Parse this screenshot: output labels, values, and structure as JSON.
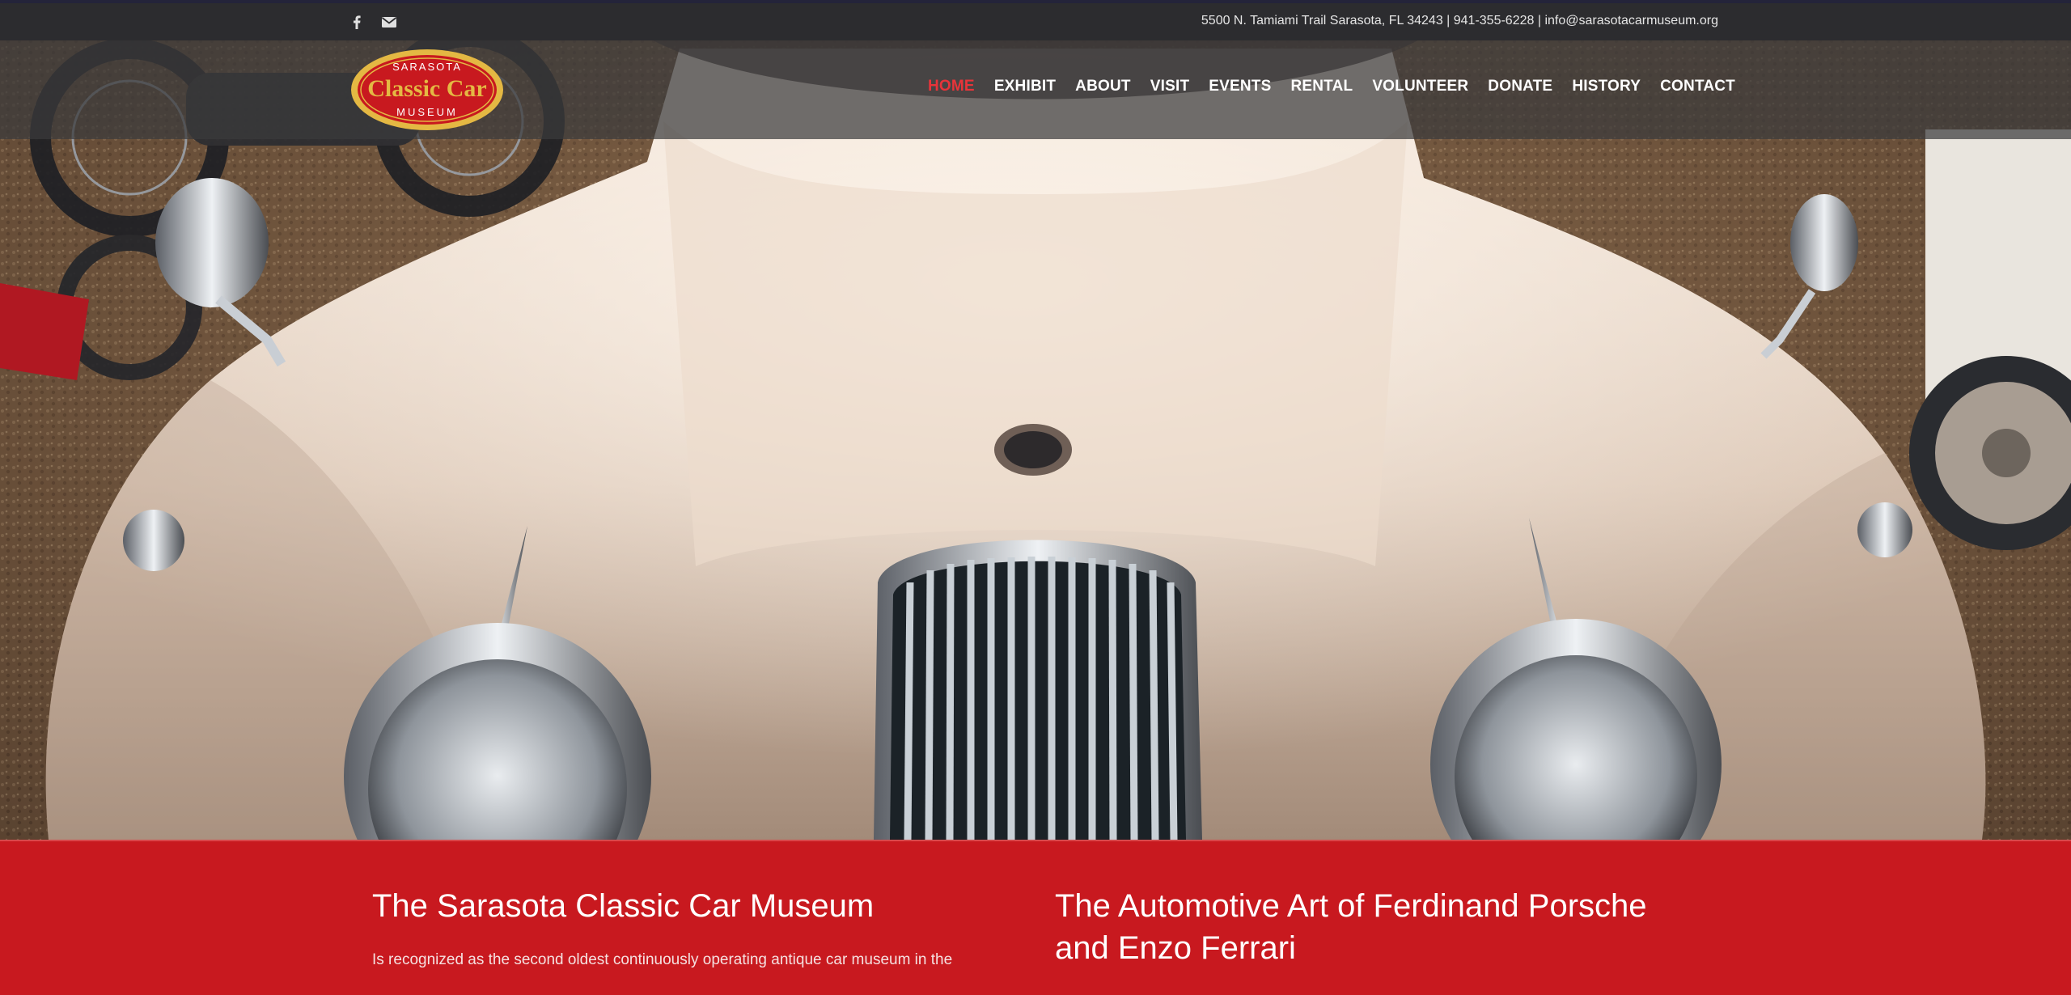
{
  "topbar": {
    "social_icons": [
      "facebook-icon",
      "envelope-icon"
    ],
    "contact_line": "5500 N. Tamiami Trail Sarasota, FL 34243 | 941-355-6228 | info@sarasotacarmuseum.org"
  },
  "logo": {
    "top_text": "SARASOTA",
    "main_text": "Classic Car",
    "bottom_text": "MUSEUM"
  },
  "nav": {
    "items": [
      "HOME",
      "EXHIBIT",
      "ABOUT",
      "VISIT",
      "EVENTS",
      "RENTAL",
      "VOLUNTEER",
      "DONATE",
      "HISTORY",
      "CONTACT"
    ],
    "active": "HOME"
  },
  "intro": {
    "left_title": "The Sarasota Classic Car Museum",
    "left_text": "Is recognized as the second oldest continuously operating antique car museum in the",
    "right_title": "The Automotive Art of Ferdinand Porsche and Enzo Ferrari"
  },
  "colors": {
    "accent_red": "#c8191f",
    "nav_active": "#e8343a",
    "topbar_bg": "#2c2c2f",
    "logo_gold": "#e4b843"
  }
}
